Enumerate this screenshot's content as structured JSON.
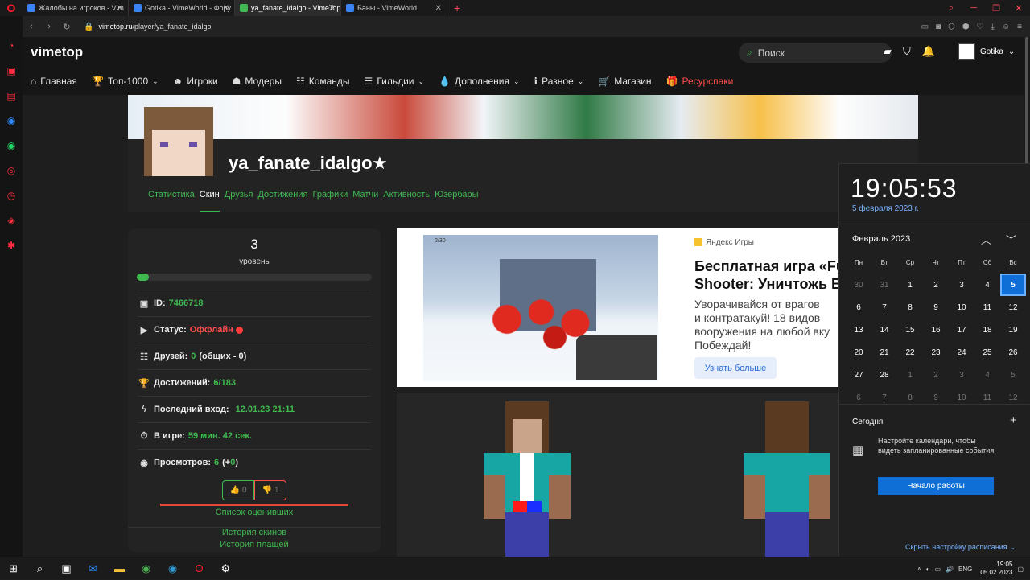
{
  "browser": {
    "tabs": [
      {
        "title": "Жалобы на игроков - Vim",
        "active": false
      },
      {
        "title": "Gotika - VimeWorld - Фору",
        "active": false
      },
      {
        "title": "ya_fanate_idalgo - VimeTop",
        "active": true
      },
      {
        "title": "Баны - VimeWorld",
        "active": false
      }
    ],
    "url_host": "vimetop.ru",
    "url_path": "/player/ya_fanate_idalgo"
  },
  "site": {
    "logo": "vimetop",
    "search_placeholder": "Поиск",
    "username": "Gotika",
    "menu": [
      {
        "label": "Главная",
        "icon": "home-icon",
        "has_caret": false
      },
      {
        "label": "Топ-1000",
        "icon": "trophy-icon",
        "has_caret": true
      },
      {
        "label": "Игроки",
        "icon": "user-plus-icon",
        "has_caret": false
      },
      {
        "label": "Модеры",
        "icon": "moderator-icon",
        "has_caret": false
      },
      {
        "label": "Команды",
        "icon": "users-icon",
        "has_caret": false
      },
      {
        "label": "Гильдии",
        "icon": "guild-icon",
        "has_caret": true
      },
      {
        "label": "Дополнения",
        "icon": "drop-icon",
        "has_caret": true
      },
      {
        "label": "Разное",
        "icon": "info-icon",
        "has_caret": true
      },
      {
        "label": "Магазин",
        "icon": "cart-icon",
        "has_caret": false
      },
      {
        "label": "Ресурспаки",
        "icon": "gift-icon",
        "has_caret": false
      }
    ]
  },
  "profile": {
    "name": "ya_fanate_idalgo",
    "tabs": [
      "Статистика",
      "Скин",
      "Друзья",
      "Достижения",
      "Графики",
      "Матчи",
      "Активность",
      "Юзербары"
    ],
    "active_tab": "Скин",
    "level": "3",
    "level_label": "уровень",
    "level_progress": 0.05,
    "id_label": "ID:",
    "id_value": "7466718",
    "status_label": "Статус:",
    "status_value": "Оффлайн",
    "friends_label": "Друзей:",
    "friends_value": "0",
    "friends_total": "(общих - 0)",
    "achievements_label": "Достижений:",
    "achievements_value": "6/183",
    "last_login_label": "Последний вход:",
    "last_login_value": "12.01.23 21:11",
    "ingame_label": "В игре:",
    "ingame_value": "59 мин. 42 сек.",
    "views_label": "Просмотров:",
    "views_value": "6",
    "views_open": "(+",
    "views_delta": "0",
    "views_close": ")",
    "likes": "0",
    "dislikes": "1",
    "raters_link": "Список оценивших",
    "skins_history": "История скинов",
    "capes_history": "История плащей"
  },
  "ad": {
    "source": "Яндекс Игры",
    "title_line1": "Бесплатная игра «Fu",
    "title_line2": "Shooter: Уничтожь В",
    "desc1": "Уворачивайся от врагов",
    "desc2": "и контратакуй! 18 видов",
    "desc3": "вооружения на любой вку",
    "desc4": "Побеждай!",
    "button": "Узнать больше",
    "hud": "2/30"
  },
  "calendar": {
    "time": "19:05:53",
    "date": "5 февраля 2023 г.",
    "month": "Февраль 2023",
    "weekdays": [
      "Пн",
      "Вт",
      "Ср",
      "Чт",
      "Пт",
      "Сб",
      "Вс"
    ],
    "days": [
      {
        "d": "30",
        "dim": true
      },
      {
        "d": "31",
        "dim": true
      },
      {
        "d": "1"
      },
      {
        "d": "2"
      },
      {
        "d": "3"
      },
      {
        "d": "4"
      },
      {
        "d": "5",
        "sel": true
      },
      {
        "d": "6"
      },
      {
        "d": "7"
      },
      {
        "d": "8"
      },
      {
        "d": "9"
      },
      {
        "d": "10"
      },
      {
        "d": "11"
      },
      {
        "d": "12"
      },
      {
        "d": "13"
      },
      {
        "d": "14"
      },
      {
        "d": "15"
      },
      {
        "d": "16"
      },
      {
        "d": "17"
      },
      {
        "d": "18"
      },
      {
        "d": "19"
      },
      {
        "d": "20"
      },
      {
        "d": "21"
      },
      {
        "d": "22"
      },
      {
        "d": "23"
      },
      {
        "d": "24"
      },
      {
        "d": "25"
      },
      {
        "d": "26"
      },
      {
        "d": "27"
      },
      {
        "d": "28"
      },
      {
        "d": "1",
        "dim": true
      },
      {
        "d": "2",
        "dim": true
      },
      {
        "d": "3",
        "dim": true
      },
      {
        "d": "4",
        "dim": true
      },
      {
        "d": "5",
        "dim": true
      },
      {
        "d": "6",
        "dim": true
      },
      {
        "d": "7",
        "dim": true
      },
      {
        "d": "8",
        "dim": true
      },
      {
        "d": "9",
        "dim": true
      },
      {
        "d": "10",
        "dim": true
      },
      {
        "d": "11",
        "dim": true
      },
      {
        "d": "12",
        "dim": true
      }
    ],
    "today": "Сегодня",
    "message": "Настройте календари, чтобы видеть запланированные события",
    "start_button": "Начало работы",
    "hide_schedule": "Скрыть настройку расписания"
  },
  "taskbar": {
    "lang": "ENG",
    "time": "19:05",
    "date": "05.02.2023"
  }
}
